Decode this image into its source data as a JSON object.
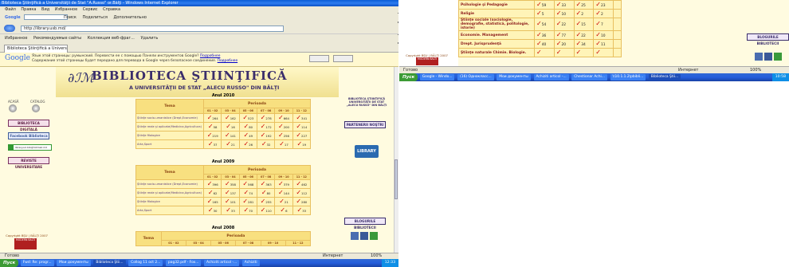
{
  "window": {
    "title": "Biblioteca Ştiinţifică a Universităţii de Stat \"A.Russo\" or.Bălţi - Windows Internet Explorer",
    "menu": [
      "Файл",
      "Правка",
      "Вид",
      "Избранное",
      "Сервис",
      "Справка"
    ],
    "search_label": "Google",
    "search_value": "",
    "toolbar_items": [
      "Поиск",
      "Поделиться",
      "Дополнительно"
    ],
    "address": "http://library.usb.md/",
    "favorites_label": "Избранное",
    "favorites_items": [
      "Рекомендуемые сайты",
      "Коллекция веб-фраг...",
      "Удалить"
    ],
    "tab_label": "Biblioteca Ştiinţifică a Universităţii de Stat \"A..."
  },
  "translate_bar": {
    "logo": "Google",
    "text": "Язык этой страницы: румынский. Перевести ее с помощью Панели инструментов Google?",
    "link": "Подробнее",
    "subtext": "Содержание этой страницы будет передано для перевода в Google через безопасное соединение.",
    "sublink": "Подробнее"
  },
  "banner": {
    "logo": "∂ℐℳ",
    "title": "BIBLIOTECA ŞTIINŢIFICĂ",
    "subtitle": "A UNIVERSITĂŢII DE STAT „ALECU RUSSO\" DIN BĂLŢI"
  },
  "left_sidebar": {
    "acasa": "ACASĂ",
    "catalog": "CATALOG",
    "buttons": [
      "BIBLIOTECA DIGITALĂ",
      "Facebook Biblioteca",
      "REVISTE UNIVERSITARE"
    ],
    "contact": "library.sci.bib@hotmail.md",
    "copyright": "Copyright BŞU | BĂLŢI 2007",
    "badge": "MODERN BALTI"
  },
  "right_sidebar": {
    "top": "BIBLIOTECA ŞTIINŢIFICĂ UNIVERSITĂŢII DE STAT „ALECU RUSSO\" DIN BĂLŢI",
    "parteneri": "PARTENERII NOŞTRI",
    "library": "LIBRARY",
    "blog": "BLOGURILE BIBLIOTECII"
  },
  "table_headers": {
    "tema": "Tema",
    "perioada": "Perioada",
    "months": [
      "01 - 02",
      "03 - 04",
      "05 - 06",
      "07 - 08",
      "09 - 10",
      "11 - 12"
    ]
  },
  "years": [
    {
      "year": "Anul 2010",
      "rows": [
        {
          "tema": "Ştiinţe socio-umanistice (Drept,Economie)",
          "values": [
            "264",
            "162",
            "523",
            "278",
            "664",
            "341"
          ]
        },
        {
          "tema": "Ştiinţe reale şi aplicate(Medicina,Agricultura)",
          "values": [
            "58",
            "16",
            "80",
            "172",
            "200",
            "114"
          ]
        },
        {
          "tema": "Ştiinţe filologice",
          "values": [
            "219",
            "141",
            "49",
            "192",
            "256",
            "227"
          ]
        },
        {
          "tema": "Arta,Sport",
          "values": [
            "37",
            "21",
            "26",
            "32",
            "17",
            "19"
          ]
        }
      ]
    },
    {
      "year": "Anul 2009",
      "rows": [
        {
          "tema": "Ştiinţe socio-umanistice (Drept,Economie)",
          "values": [
            "396",
            "358",
            "568",
            "363",
            "379",
            "462"
          ]
        },
        {
          "tema": "Ştiinţe reale şi aplicate(Medicina,Agricultura)",
          "values": [
            "62",
            "137",
            "74",
            "80",
            "144",
            "112"
          ]
        },
        {
          "tema": "Ştiinţe filologice",
          "values": [
            "165",
            "101",
            "281",
            "255",
            "21",
            "280"
          ]
        },
        {
          "tema": "Arta,Sport",
          "values": [
            "30",
            "33",
            "70",
            "110",
            "6",
            "33"
          ]
        }
      ]
    },
    {
      "year": "Anul 2008",
      "rows": []
    }
  ],
  "status_left": {
    "text": "Готово",
    "zone": "Интернет",
    "zoom": "100%"
  },
  "taskbar_left": {
    "start": "Пуск",
    "tasks": [
      "Fwd: Re: progr...",
      "Мои документы",
      "Biblioteca Ştii...",
      "Collog 11 oct 2...",
      "pag32.pdf - Fox...",
      "Achiziti articol -...",
      "Achiziti"
    ],
    "clock": "12:33"
  },
  "right_window": {
    "rows": [
      {
        "tema": "Psihologie şi Pedagogie",
        "values": [
          "59",
          "33",
          "25",
          "23"
        ]
      },
      {
        "tema": "Religie",
        "values": [
          "5",
          "10",
          "2",
          "2"
        ]
      },
      {
        "tema": "Ştiinţe sociale (sociologie, demografie, statistică, politologie, istorie)",
        "values": [
          "54",
          "22",
          "15",
          "7"
        ]
      },
      {
        "tema": "Economie. Management",
        "values": [
          "36",
          "77",
          "22",
          "10"
        ]
      },
      {
        "tema": "Drept. Jurisprudenţă",
        "values": [
          "40",
          "20",
          "34",
          "11"
        ]
      },
      {
        "tema": "Ştiinţe naturale Chimie. Biologie.",
        "values": []
      }
    ],
    "copyright": "Copyright BŞU | BĂLŢI 2007",
    "badge": "MODERN BALTI",
    "blog": "BLOGURILE BIBLIOTECII",
    "status": "Готово",
    "zone": "Интернет",
    "zoom": "100%"
  },
  "taskbar_right": {
    "start": "Пуск",
    "tasks": [
      "Google - Windo...",
      "(16) Однокласс...",
      "Мои документы",
      "Achiziti articol -...",
      "Chestionar Achi...",
      "\\\\10.1.1.2\\pbibli...",
      "Biblioteca Ştii..."
    ],
    "clock": "10:58"
  }
}
